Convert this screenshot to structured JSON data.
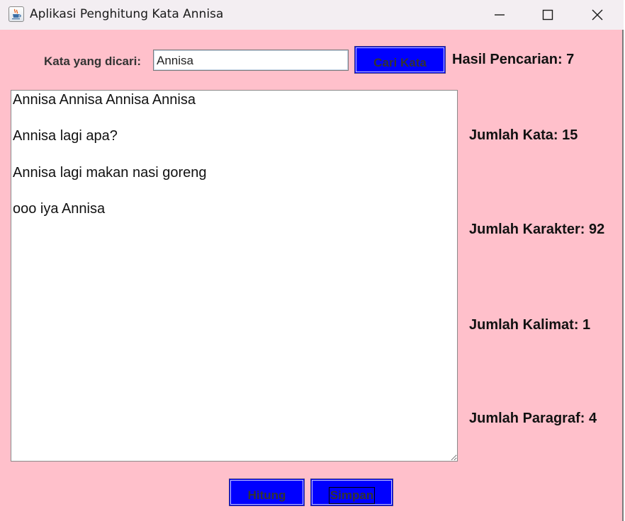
{
  "window": {
    "title": "Aplikasi Penghitung Kata Annisa",
    "app_icon": "java-cup-icon",
    "controls": [
      "minimize-icon",
      "maximize-icon",
      "close-icon"
    ]
  },
  "colors": {
    "background": "#ffc0cb",
    "button": "#0000ff",
    "titlebar": "#f3eef2"
  },
  "search": {
    "label": "Kata yang dicari:",
    "value": "Annisa",
    "button_label": "Cari Kata",
    "result": "Hasil Pencarian: 7"
  },
  "editor": {
    "text": "Annisa Annisa Annisa Annisa\n\nAnnisa lagi apa?\n\nAnnisa lagi makan nasi goreng\n\nooo iya Annisa"
  },
  "stats": {
    "words": "Jumlah Kata: 15",
    "characters": "Jumlah Karakter: 92",
    "sentences": "Jumlah Kalimat: 1",
    "paragraphs": "Jumlah Paragraf: 4"
  },
  "actions": {
    "count_label": "Hitung",
    "save_label": "Simpan"
  }
}
